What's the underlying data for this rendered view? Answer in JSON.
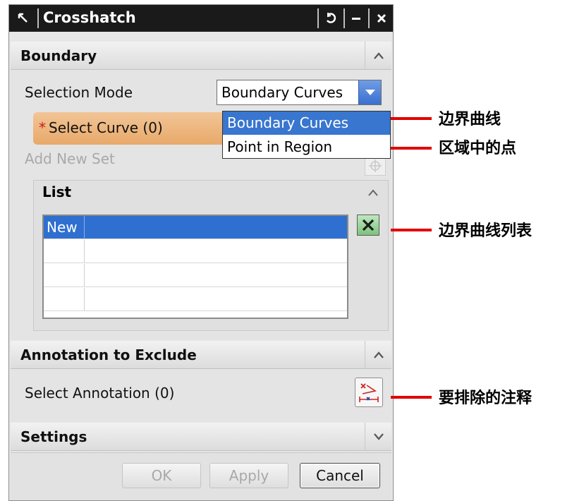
{
  "window": {
    "title": "Crosshatch"
  },
  "boundary": {
    "title": "Boundary",
    "selection_mode_label": "Selection Mode",
    "selection_mode_value": "Boundary Curves",
    "dropdown_options": [
      "Boundary Curves",
      "Point in Region"
    ],
    "required_marker": "*",
    "select_curve_label": "Select Curve (0)",
    "add_new_set_label": "Add New Set"
  },
  "list": {
    "title": "List",
    "rows": [
      "New",
      "",
      "",
      ""
    ]
  },
  "annotation": {
    "title": "Annotation to Exclude",
    "select_label": "Select Annotation (0)"
  },
  "settings": {
    "title": "Settings"
  },
  "buttons": {
    "ok": "OK",
    "apply": "Apply",
    "cancel": "Cancel"
  },
  "callouts": {
    "boundary_curves": "边界曲线",
    "point_in_region": "区域中的点",
    "curve_list": "边界曲线列表",
    "annotation_exclude": "要排除的注释"
  },
  "colors": {
    "titlebar": "#1a1a1a",
    "selection_highlight": "#3876cf",
    "required_row": "#e8a96a",
    "callout_line": "#e10000"
  }
}
